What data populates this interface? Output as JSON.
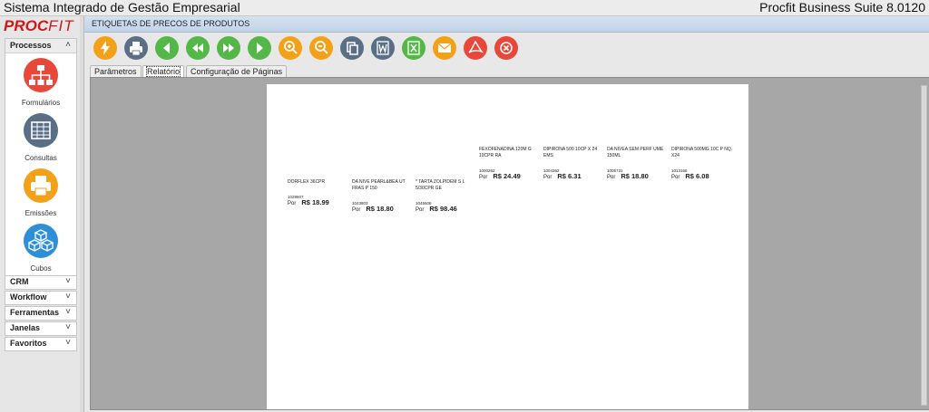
{
  "window": {
    "title": "Sistema Integrado de Gestão Empresarial",
    "suite": "Procfit Business Suite 8.0120"
  },
  "logo": {
    "part1": "PROC",
    "part2": "FIT"
  },
  "sidebar": {
    "processos_label": "Processos",
    "items": [
      {
        "label": "Formulários",
        "icon": "hierarchy-icon",
        "color": "#e8483a"
      },
      {
        "label": "Consultas",
        "icon": "table-icon",
        "color": "#5a6e86"
      },
      {
        "label": "Emissões",
        "icon": "printer-icon",
        "color": "#f4a11a"
      },
      {
        "label": "Cubos",
        "icon": "cubes-icon",
        "color": "#2e8fd6"
      }
    ],
    "categories": [
      {
        "label": "CRM"
      },
      {
        "label": "Workflow"
      },
      {
        "label": "Ferramentas"
      },
      {
        "label": "Janelas"
      },
      {
        "label": "Favoritos"
      }
    ]
  },
  "main": {
    "title": "ETIQUETAS DE PRECOS DE PRODUTOS",
    "toolbar": [
      {
        "name": "lightning-icon",
        "color": "#f4a11a"
      },
      {
        "name": "printer-icon",
        "color": "#5a6e86"
      },
      {
        "name": "first-page-icon",
        "color": "#54b848"
      },
      {
        "name": "previous-page-icon",
        "color": "#54b848"
      },
      {
        "name": "next-page-icon",
        "color": "#54b848"
      },
      {
        "name": "last-page-icon",
        "color": "#54b848"
      },
      {
        "name": "zoom-in-icon",
        "color": "#f4a11a"
      },
      {
        "name": "zoom-out-icon",
        "color": "#f4a11a"
      },
      {
        "name": "copy-icon",
        "color": "#5a6e86"
      },
      {
        "name": "word-export-icon",
        "color": "#5a6e86"
      },
      {
        "name": "excel-export-icon",
        "color": "#54b848"
      },
      {
        "name": "email-icon",
        "color": "#f4a11a"
      },
      {
        "name": "pdf-export-icon",
        "color": "#e8483a"
      },
      {
        "name": "close-icon",
        "color": "#e8483a"
      }
    ],
    "tabs": [
      {
        "label": "Parâmetros"
      },
      {
        "label": "Relatório"
      },
      {
        "label": "Configuração de Páginas"
      }
    ]
  },
  "labels": [
    {
      "name": "FEXOFENADINA 120M G 10CPR RA",
      "code": "1000262",
      "por": "Por",
      "price": "R$ 24.49"
    },
    {
      "name": "DIPIRONA 500 10CP X 24 EMS",
      "code": "1004362",
      "por": "Por",
      "price": "R$ 6.31"
    },
    {
      "name": "DA NIVEA SEM PERF UME 150ML",
      "code": "1005731",
      "por": "Por",
      "price": "R$ 18.80"
    },
    {
      "name": "DIPIRONA 500MG 10C P NQ. X24",
      "code": "1013166",
      "por": "Por",
      "price": "R$ 6.08"
    },
    {
      "name": "DORFLEX 36CPR",
      "code": "1028607",
      "por": "Por",
      "price": "R$ 18.99"
    },
    {
      "name": "DA NIVE PEARL&BEA UT FRAS P 150",
      "code": "1043803",
      "por": "Por",
      "price": "R$ 18.80"
    },
    {
      "name": "* TARTA ZOLPIDEM S L 5/30CPR GE",
      "code": "1045606",
      "por": "Por",
      "price": "R$ 98.46"
    }
  ]
}
